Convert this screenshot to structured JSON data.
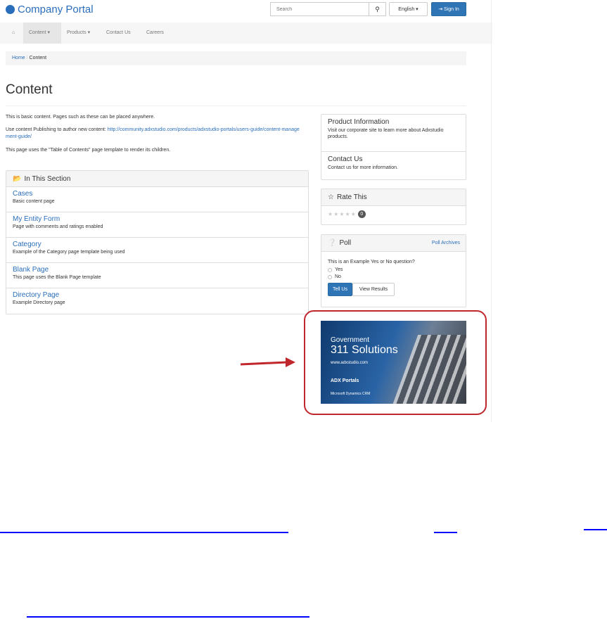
{
  "header": {
    "logo": "Company Portal",
    "search_placeholder": "Search",
    "language": "English ▾",
    "sign_in": "⇥ Sign In"
  },
  "nav": {
    "home_icon": "home-icon",
    "items": [
      "Content ▾",
      "Products ▾",
      "Contact Us",
      "Careers"
    ]
  },
  "breadcrumb": {
    "home": "Home",
    "sep": "/",
    "current": "Content"
  },
  "page": {
    "title": "Content",
    "p1": "This is basic content. Pages such as these can be placed anywhere.",
    "p2_prefix": "Use content Publishing to author new content: ",
    "p2_link": "http://community.adxstudio.com/products/adxstudio-portals/users-guide/content-management-guide/",
    "p3": "This page uses the \"Table of Contents\" page template to render its children."
  },
  "section": {
    "title": "In This Section",
    "items": [
      {
        "title": "Cases",
        "desc": "Basic content page"
      },
      {
        "title": "My Entity Form",
        "desc": "Page with comments and ratings enabled"
      },
      {
        "title": "Category",
        "desc": "Example of the Category page template being used"
      },
      {
        "title": "Blank Page",
        "desc": "This page uses the Blank Page template"
      },
      {
        "title": "Directory Page",
        "desc": "Example Directory page"
      }
    ]
  },
  "sidebar": {
    "links": [
      {
        "title": "Product Information",
        "desc": "Visit our corporate site to learn more about Adxstudio products."
      },
      {
        "title": "Contact Us",
        "desc": "Contact us for more information."
      }
    ],
    "rate": {
      "title": "Rate This",
      "stars": "★★★★★",
      "count": "0",
      "rating": 0
    },
    "poll": {
      "title": "Poll",
      "archives": "Poll Archives",
      "question": "This is an Example Yes or No question?",
      "options": [
        "Yes",
        "No"
      ],
      "submit": "Tell Us",
      "results": "View Results"
    }
  },
  "banner": {
    "line1": "Government",
    "line2": "311 Solutions",
    "url": "www.adxstudio.com",
    "brand": "ADX Portals",
    "crm": "Microsoft Dynamics CRM"
  },
  "colors": {
    "accent": "#2f74b5",
    "annotation": "#c0272d",
    "link_underline": "#0000ff"
  }
}
